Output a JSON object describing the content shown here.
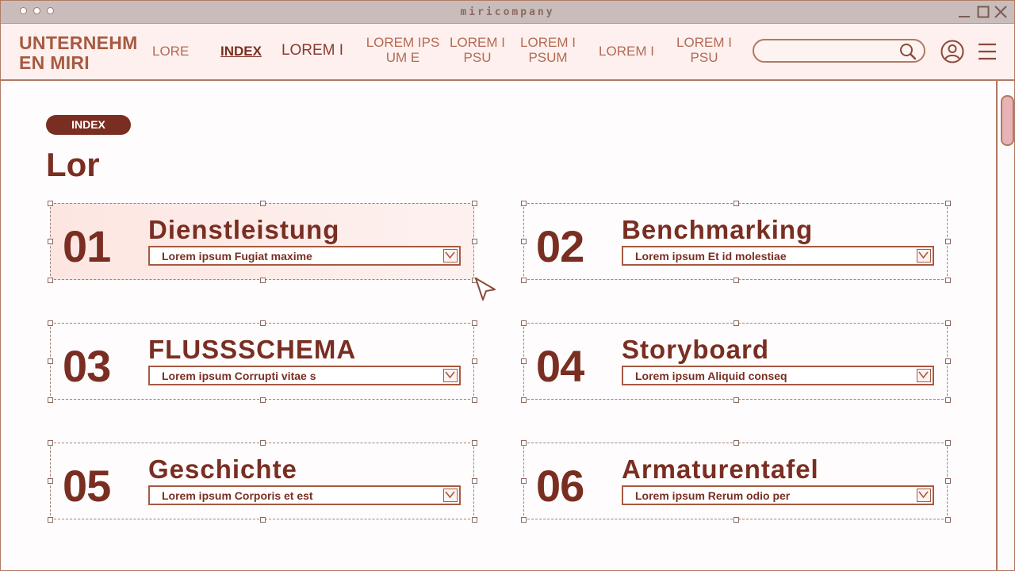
{
  "app": {
    "title": "miricompany"
  },
  "nav": {
    "brand": "UNTERNEHM EN MIRI",
    "items": [
      {
        "label": "LORE"
      },
      {
        "label": "INDEX"
      },
      {
        "label": "LOREM I"
      },
      {
        "label": "LOREM IPS UM E"
      },
      {
        "label": "LOREM I PSU"
      },
      {
        "label": "LOREM I PSUM"
      },
      {
        "label": "LOREM I"
      },
      {
        "label": "LOREM I PSU"
      }
    ],
    "search": {
      "placeholder": "",
      "value": ""
    },
    "icons": [
      "search-icon",
      "user-icon",
      "menu-icon"
    ]
  },
  "main": {
    "tag": "INDEX",
    "title": "Lor",
    "cards": [
      {
        "number": "01",
        "title": "Dienstleistung",
        "select": "Lorem ipsum Fugiat maxime"
      },
      {
        "number": "02",
        "title": "Benchmarking",
        "select": "Lorem ipsum Et id molestiae"
      },
      {
        "number": "03",
        "title": "FLUSSSCHEMA",
        "select": "Lorem ipsum Corrupti vitae s"
      },
      {
        "number": "04",
        "title": "Storyboard",
        "select": "Lorem ipsum Aliquid conseq"
      },
      {
        "number": "05",
        "title": "Geschichte",
        "select": "Lorem ipsum Corporis et est"
      },
      {
        "number": "06",
        "title": "Armaturentafel",
        "select": "Lorem ipsum Rerum odio per"
      }
    ]
  },
  "colors": {
    "accent": "#7a2e22",
    "brand": "#a65a41",
    "nav_bg": "#fdf0ee",
    "hover_card": "#fde6e2"
  }
}
